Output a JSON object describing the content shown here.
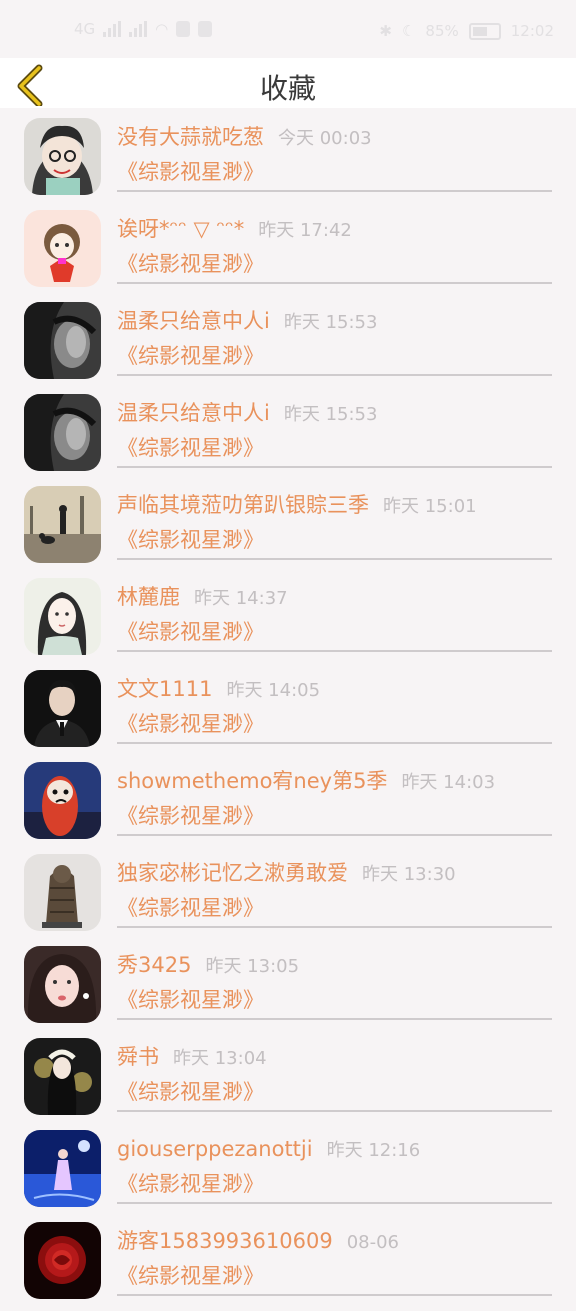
{
  "status_bar": {
    "network_label": "4G",
    "battery_percent": "85%",
    "time": "12:02"
  },
  "header": {
    "title": "收藏",
    "back_icon": "chevron-left-icon"
  },
  "colors": {
    "accent": "#e9925c",
    "back_icon": "#c9a51a",
    "time_text": "#c3bfc1",
    "background": "#f7f4f5"
  },
  "favorites": [
    {
      "name": "没有大蒜就吃葱",
      "time": "今天 00:03",
      "work": "《综影视星渺》",
      "avatar": "cartoon-girl"
    },
    {
      "name": "诶呀*ᵔᵔ ▽ ᵔᵔ*",
      "time": "昨天 17:42",
      "work": "《综影视星渺》",
      "avatar": "anime-girl-red"
    },
    {
      "name": "温柔只给意中人i",
      "time": "昨天 15:53",
      "work": "《综影视星渺》",
      "avatar": "bw-portrait"
    },
    {
      "name": "温柔只给意中人i",
      "time": "昨天 15:53",
      "work": "《综影视星渺》",
      "avatar": "bw-portrait"
    },
    {
      "name": "声临其境蒞叻第趴银賩三季",
      "time": "昨天 15:01",
      "work": "《综影视星渺》",
      "avatar": "street-dog"
    },
    {
      "name": "林麓鹿",
      "time": "昨天 14:37",
      "work": "《综影视星渺》",
      "avatar": "painted-lady"
    },
    {
      "name": "文文1111",
      "time": "昨天 14:05",
      "work": "《综影视星渺》",
      "avatar": "man-suit"
    },
    {
      "name": "showmethemo宥ney第5季",
      "time": "昨天 14:03",
      "work": "《综影视星渺》",
      "avatar": "red-character"
    },
    {
      "name": "独家宓彬记忆之漱勇敢爱",
      "time": "昨天 13:30",
      "work": "《综影视星渺》",
      "avatar": "bronze-statue"
    },
    {
      "name": "秀3425",
      "time": "昨天 13:05",
      "work": "《综影视星渺》",
      "avatar": "selfie-girl"
    },
    {
      "name": "舜书",
      "time": "昨天 13:04",
      "work": "《综影视星渺》",
      "avatar": "dark-anime"
    },
    {
      "name": "giouserppezanottji",
      "time": "昨天 12:16",
      "work": "《综影视星渺》",
      "avatar": "blue-night"
    },
    {
      "name": "游客1583993610609",
      "time": "08-06",
      "work": "《综影视星渺》",
      "avatar": "red-rose"
    }
  ]
}
